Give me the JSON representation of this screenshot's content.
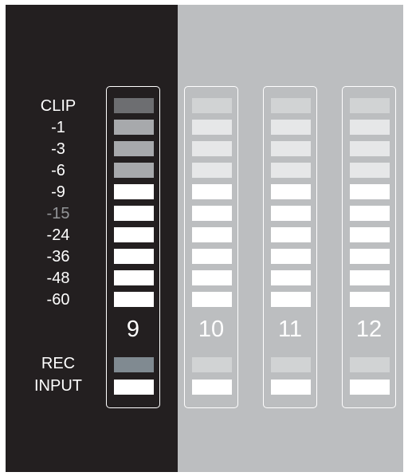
{
  "meter": {
    "scale_labels": [
      "CLIP",
      "-1",
      "-3",
      "-6",
      "-9",
      "-15",
      "-24",
      "-36",
      "-48",
      "-60"
    ],
    "rec_label": "REC",
    "input_label": "INPUT",
    "label_color": "#ffffff",
    "dim_label_color": "#939598",
    "channels": [
      {
        "number": "9",
        "active": true
      },
      {
        "number": "10",
        "active": false
      },
      {
        "number": "11",
        "active": false
      },
      {
        "number": "12",
        "active": false
      }
    ],
    "colors": {
      "dark_panel": "#231f20",
      "light_panel": "#bcbec0",
      "active_clip": "#6d6e71",
      "active_upper": "#a7a9ac",
      "active_rec": "#808a91",
      "lit": "#ffffff",
      "inactive_clip": "#d1d3d4",
      "inactive_upper": "#e6e7e8",
      "inactive_rec": "#d1d3d4"
    }
  }
}
